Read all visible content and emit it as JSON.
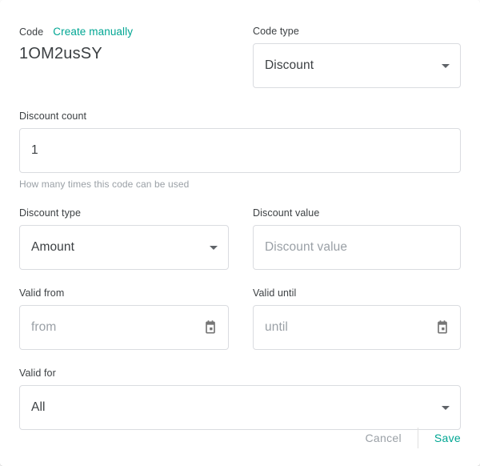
{
  "header": {
    "code_caption": "Code",
    "create_manually_label": "Create manually",
    "code_value": "1OM2usSY"
  },
  "fields": {
    "code_type": {
      "label": "Code type",
      "value": "Discount",
      "icon": "chevron-down-icon"
    },
    "discount_count": {
      "label": "Discount count",
      "value": "1",
      "helper": "How many times this code can be used"
    },
    "discount_type": {
      "label": "Discount type",
      "value": "Amount",
      "icon": "chevron-down-icon"
    },
    "discount_value": {
      "label": "Discount value",
      "value": "",
      "placeholder": "Discount value"
    },
    "valid_from": {
      "label": "Valid from",
      "value": "",
      "placeholder": "from",
      "icon": "calendar-icon"
    },
    "valid_until": {
      "label": "Valid until",
      "value": "",
      "placeholder": "until",
      "icon": "calendar-icon"
    },
    "valid_for": {
      "label": "Valid for",
      "value": "All",
      "icon": "chevron-down-icon"
    }
  },
  "footer": {
    "cancel_label": "Cancel",
    "save_label": "Save"
  },
  "colors": {
    "accent": "#00a693",
    "text": "#3c4043",
    "muted": "#9aa0a6",
    "border": "#dadce0"
  }
}
